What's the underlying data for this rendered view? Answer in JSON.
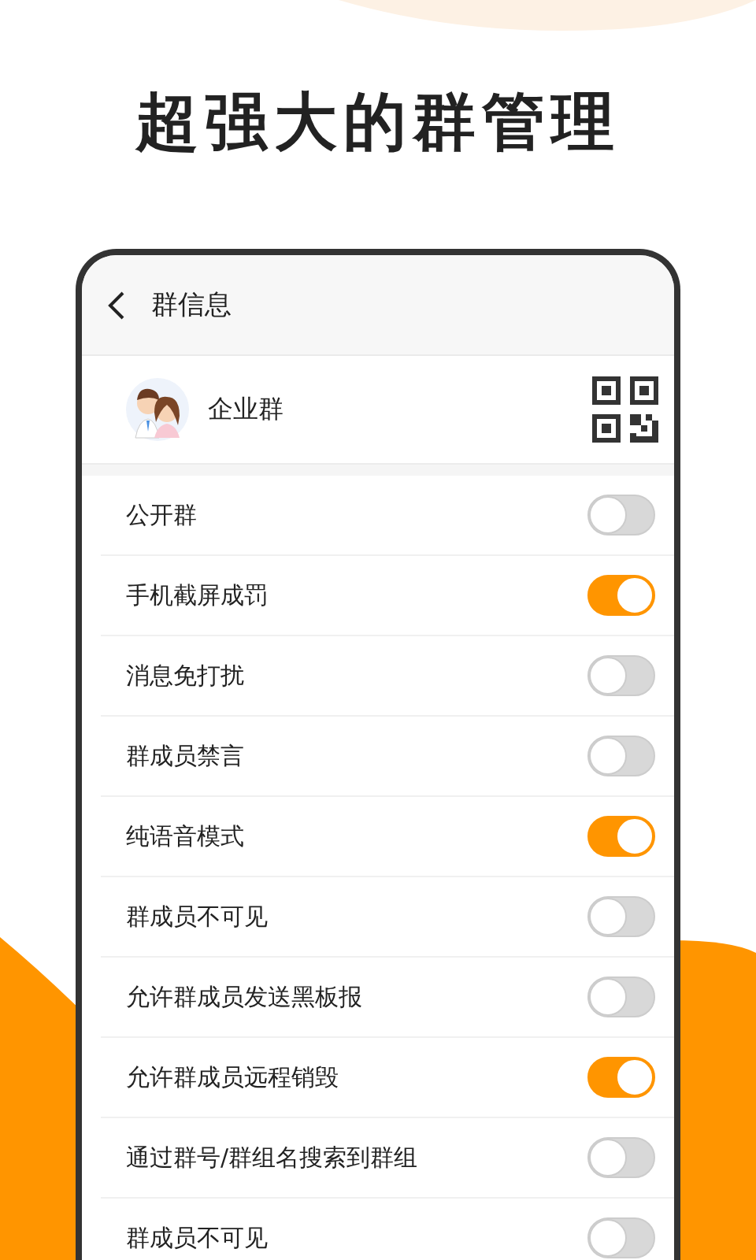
{
  "headline": "超强大的群管理",
  "screen": {
    "title": "群信息",
    "group": {
      "name": "企业群"
    },
    "settings": [
      {
        "label": "公开群",
        "on": false
      },
      {
        "label": "手机截屏成罚",
        "on": true
      },
      {
        "label": "消息免打扰",
        "on": false
      },
      {
        "label": "群成员禁言",
        "on": false
      },
      {
        "label": "纯语音模式",
        "on": true
      },
      {
        "label": "群成员不可见",
        "on": false
      },
      {
        "label": "允许群成员发送黑板报",
        "on": false
      },
      {
        "label": "允许群成员远程销毁",
        "on": true
      },
      {
        "label": "通过群号/群组名搜索到群组",
        "on": false
      },
      {
        "label": "群成员不可见",
        "on": false
      }
    ]
  }
}
